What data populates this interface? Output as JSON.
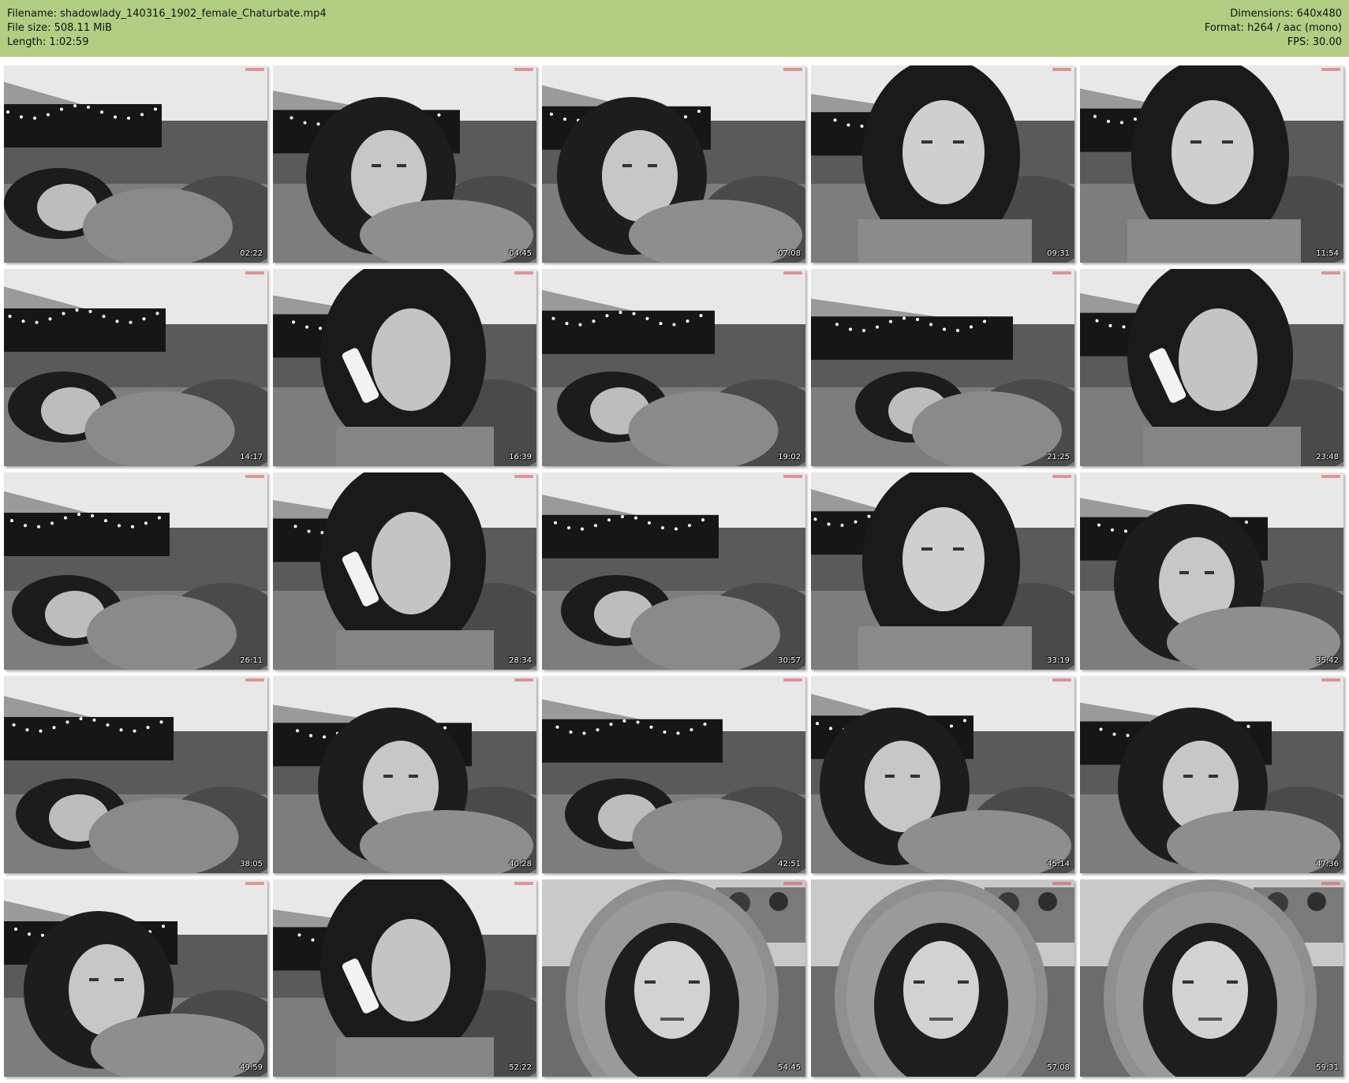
{
  "header": {
    "filename": "Filename: shadowlady_140316_1902_female_Chaturbate.mp4",
    "filesize": "File size: 508.11 MiB",
    "length": "Length: 1:02:59",
    "dimensions": "Dimensions: 640x480",
    "format": "Format: h264 / aac (mono)",
    "fps": "FPS: 30.00"
  },
  "colors": {
    "header_bg": "#b1ce83",
    "page_bg": "#ffffff",
    "timestamp": "#ffffff"
  },
  "thumbnails": [
    {
      "time": "02:22",
      "scene": "bed-lying"
    },
    {
      "time": "04:45",
      "scene": "bed-closeup"
    },
    {
      "time": "07:08",
      "scene": "bed-closeup"
    },
    {
      "time": "09:31",
      "scene": "face-front"
    },
    {
      "time": "11:54",
      "scene": "face-front"
    },
    {
      "time": "14:17",
      "scene": "bed-lying"
    },
    {
      "time": "16:39",
      "scene": "phone-closeup"
    },
    {
      "time": "19:02",
      "scene": "bed-lying"
    },
    {
      "time": "21:25",
      "scene": "bed-lying"
    },
    {
      "time": "23:48",
      "scene": "phone-closeup"
    },
    {
      "time": "26:11",
      "scene": "bed-lying"
    },
    {
      "time": "28:34",
      "scene": "phone-closeup"
    },
    {
      "time": "30:57",
      "scene": "bed-lying"
    },
    {
      "time": "33:19",
      "scene": "face-front"
    },
    {
      "time": "35:42",
      "scene": "bed-closeup"
    },
    {
      "time": "38:05",
      "scene": "bed-lying"
    },
    {
      "time": "40:28",
      "scene": "bed-closeup"
    },
    {
      "time": "42:51",
      "scene": "bed-lying"
    },
    {
      "time": "45:14",
      "scene": "bed-closeup"
    },
    {
      "time": "47:36",
      "scene": "bed-closeup"
    },
    {
      "time": "49:59",
      "scene": "bed-closeup"
    },
    {
      "time": "52:22",
      "scene": "phone-closeup"
    },
    {
      "time": "54:45",
      "scene": "hood"
    },
    {
      "time": "57:08",
      "scene": "hood"
    },
    {
      "time": "59:31",
      "scene": "hood"
    }
  ]
}
